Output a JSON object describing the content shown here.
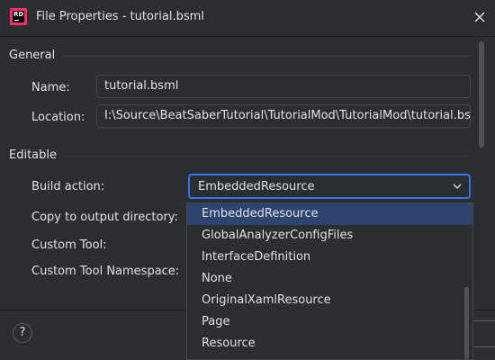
{
  "window": {
    "app_icon_text": "RD",
    "title": "File Properties - tutorial.bsml"
  },
  "general": {
    "heading": "General",
    "name_label": "Name:",
    "name_value": "tutorial.bsml",
    "location_label": "Location:",
    "location_value": "I:\\Source\\BeatSaberTutorial\\TutorialMod\\TutorialMod\\tutorial.bs"
  },
  "editable": {
    "heading": "Editable",
    "build_action_label": "Build action:",
    "build_action_value": "EmbeddedResource",
    "copy_label": "Copy to output directory:",
    "custom_tool_label": "Custom Tool:",
    "custom_tool_namespace_label": "Custom Tool Namespace:"
  },
  "dropdown": {
    "options": [
      "EmbeddedResource",
      "GlobalAnalyzerConfigFiles",
      "InterfaceDefinition",
      "None",
      "OriginalXamlResource",
      "Page",
      "Resource"
    ],
    "selected": "EmbeddedResource"
  },
  "footer": {
    "help_label": "?"
  },
  "colors": {
    "background": "#2b2d30",
    "accent": "#3574f0",
    "selection": "#2e436e",
    "text": "#dfe1e5"
  }
}
